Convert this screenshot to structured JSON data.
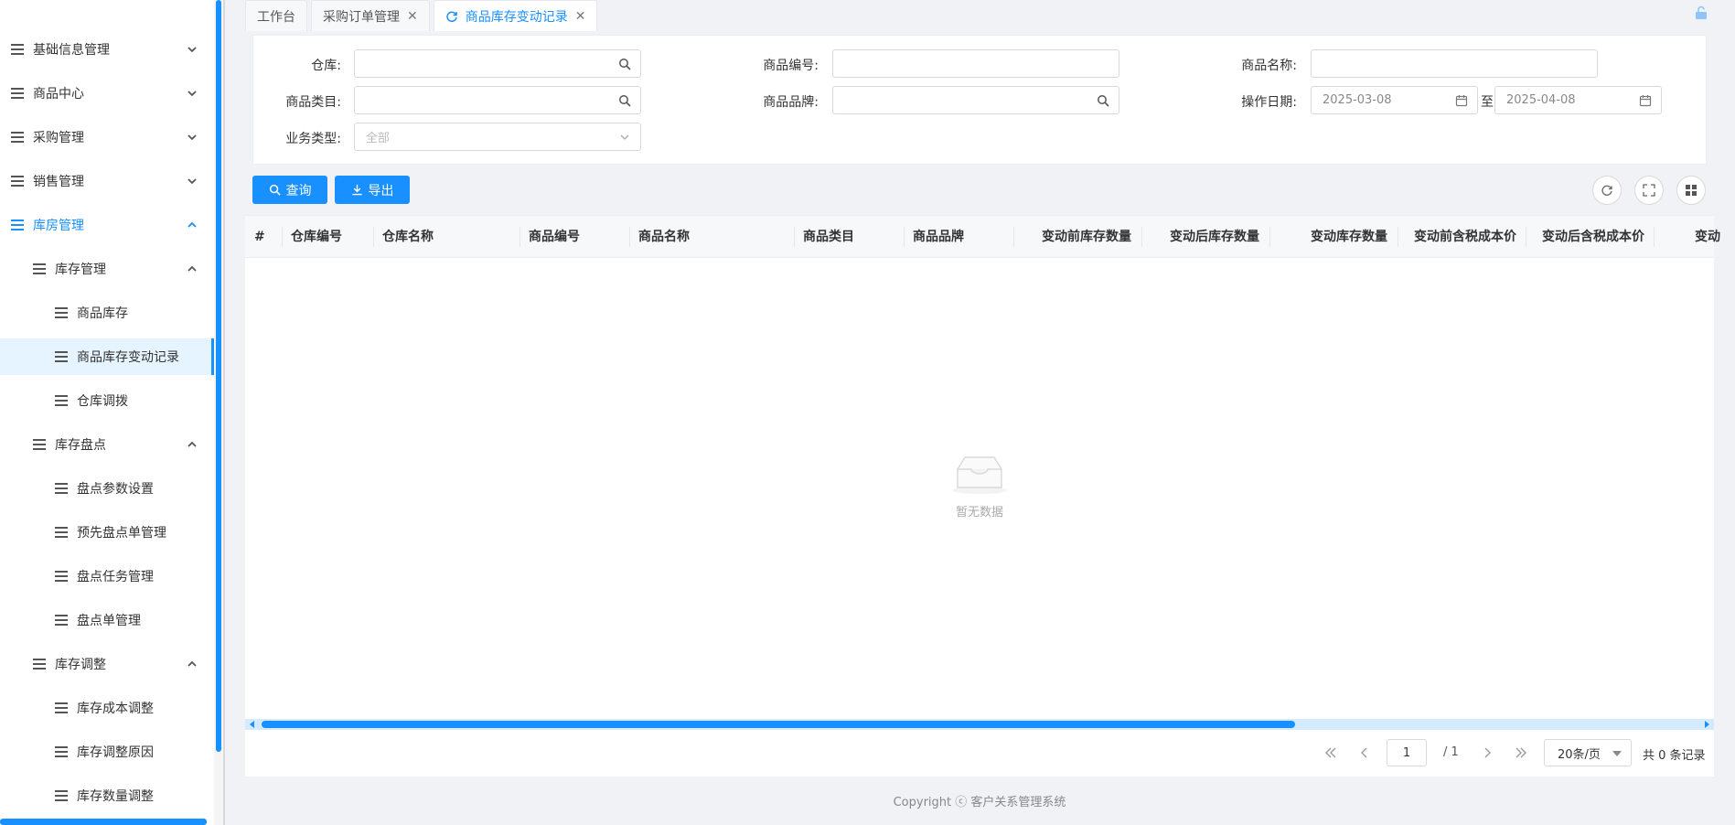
{
  "sidebar": {
    "items": [
      {
        "label": "基础信息管理",
        "level": 1,
        "chevron": "down"
      },
      {
        "label": "商品中心",
        "level": 1,
        "chevron": "down"
      },
      {
        "label": "采购管理",
        "level": 1,
        "chevron": "down"
      },
      {
        "label": "销售管理",
        "level": 1,
        "chevron": "down"
      },
      {
        "label": "库房管理",
        "level": 1,
        "chevron": "up",
        "active": true
      },
      {
        "label": "库存管理",
        "level": 2,
        "chevron": "up"
      },
      {
        "label": "商品库存",
        "level": 3
      },
      {
        "label": "商品库存变动记录",
        "level": 3,
        "selected": true
      },
      {
        "label": "仓库调拨",
        "level": 3
      },
      {
        "label": "库存盘点",
        "level": 2,
        "chevron": "up"
      },
      {
        "label": "盘点参数设置",
        "level": 3
      },
      {
        "label": "预先盘点单管理",
        "level": 3
      },
      {
        "label": "盘点任务管理",
        "level": 3
      },
      {
        "label": "盘点单管理",
        "level": 3
      },
      {
        "label": "库存调整",
        "level": 2,
        "chevron": "up"
      },
      {
        "label": "库存成本调整",
        "level": 3
      },
      {
        "label": "库存调整原因",
        "level": 3
      },
      {
        "label": "库存数量调整",
        "level": 3
      }
    ]
  },
  "tabs": [
    {
      "label": "工作台",
      "closable": false,
      "active": false
    },
    {
      "label": "采购订单管理",
      "closable": true,
      "active": false
    },
    {
      "label": "商品库存变动记录",
      "closable": true,
      "active": true,
      "icon": "refresh-icon"
    }
  ],
  "filters": {
    "warehouse": {
      "label": "仓库:",
      "value": ""
    },
    "product_code": {
      "label": "商品编号:",
      "value": ""
    },
    "product_name": {
      "label": "商品名称:",
      "value": ""
    },
    "product_category": {
      "label": "商品类目:",
      "value": ""
    },
    "product_brand": {
      "label": "商品品牌:",
      "value": ""
    },
    "operation_date": {
      "label": "操作日期:",
      "start": "2025-03-08",
      "separator": "至",
      "end": "2025-04-08"
    },
    "business_type": {
      "label": "业务类型:",
      "value": "全部"
    }
  },
  "toolbar": {
    "query_label": "查询",
    "export_label": "导出"
  },
  "table": {
    "columns": [
      "#",
      "仓库编号",
      "仓库名称",
      "商品编号",
      "商品名称",
      "商品类目",
      "商品品牌",
      "变动前库存数量",
      "变动后库存数量",
      "变动库存数量",
      "变动前含税成本价",
      "变动后含税成本价",
      "变动"
    ],
    "rows": [],
    "empty_text": "暂无数据"
  },
  "pagination": {
    "current_page": "1",
    "total_pages": "/ 1",
    "page_size": "20条/页",
    "total_records": "共 0 条记录"
  },
  "footer": {
    "copyright": "Copyright ⓒ 客户关系管理系统"
  },
  "colors": {
    "primary": "#1890ff",
    "selected_bg": "#e6f4ff"
  }
}
